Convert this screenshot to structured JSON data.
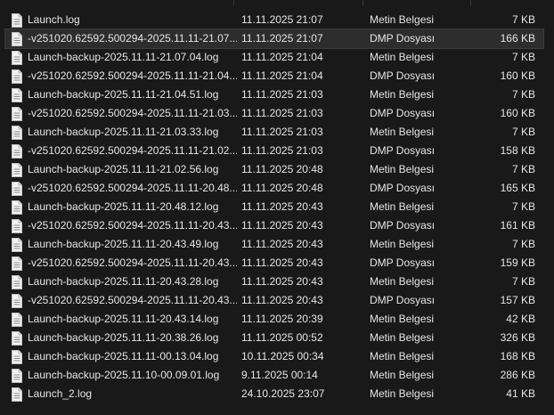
{
  "files": [
    {
      "name": "Launch.log",
      "modified": "11.11.2025 21:07",
      "type": "Metin Belgesi",
      "size": "7 KB"
    },
    {
      "name": "-v251020.62592.500294-2025.11.11-21.07....",
      "modified": "11.11.2025 21:07",
      "type": "DMP Dosyası",
      "size": "166 KB"
    },
    {
      "name": "Launch-backup-2025.11.11-21.07.04.log",
      "modified": "11.11.2025 21:04",
      "type": "Metin Belgesi",
      "size": "7 KB"
    },
    {
      "name": "-v251020.62592.500294-2025.11.11-21.04....",
      "modified": "11.11.2025 21:04",
      "type": "DMP Dosyası",
      "size": "160 KB"
    },
    {
      "name": "Launch-backup-2025.11.11-21.04.51.log",
      "modified": "11.11.2025 21:03",
      "type": "Metin Belgesi",
      "size": "7 KB"
    },
    {
      "name": "-v251020.62592.500294-2025.11.11-21.03....",
      "modified": "11.11.2025 21:03",
      "type": "DMP Dosyası",
      "size": "160 KB"
    },
    {
      "name": "Launch-backup-2025.11.11-21.03.33.log",
      "modified": "11.11.2025 21:03",
      "type": "Metin Belgesi",
      "size": "7 KB"
    },
    {
      "name": "-v251020.62592.500294-2025.11.11-21.02....",
      "modified": "11.11.2025 21:03",
      "type": "DMP Dosyası",
      "size": "158 KB"
    },
    {
      "name": "Launch-backup-2025.11.11-21.02.56.log",
      "modified": "11.11.2025 20:48",
      "type": "Metin Belgesi",
      "size": "7 KB"
    },
    {
      "name": "-v251020.62592.500294-2025.11.11-20.48....",
      "modified": "11.11.2025 20:48",
      "type": "DMP Dosyası",
      "size": "165 KB"
    },
    {
      "name": "Launch-backup-2025.11.11-20.48.12.log",
      "modified": "11.11.2025 20:43",
      "type": "Metin Belgesi",
      "size": "7 KB"
    },
    {
      "name": "-v251020.62592.500294-2025.11.11-20.43....",
      "modified": "11.11.2025 20:43",
      "type": "DMP Dosyası",
      "size": "161 KB"
    },
    {
      "name": "Launch-backup-2025.11.11-20.43.49.log",
      "modified": "11.11.2025 20:43",
      "type": "Metin Belgesi",
      "size": "7 KB"
    },
    {
      "name": "-v251020.62592.500294-2025.11.11-20.43....",
      "modified": "11.11.2025 20:43",
      "type": "DMP Dosyası",
      "size": "159 KB"
    },
    {
      "name": "Launch-backup-2025.11.11-20.43.28.log",
      "modified": "11.11.2025 20:43",
      "type": "Metin Belgesi",
      "size": "7 KB"
    },
    {
      "name": "-v251020.62592.500294-2025.11.11-20.43....",
      "modified": "11.11.2025 20:43",
      "type": "DMP Dosyası",
      "size": "157 KB"
    },
    {
      "name": "Launch-backup-2025.11.11-20.43.14.log",
      "modified": "11.11.2025 20:39",
      "type": "Metin Belgesi",
      "size": "42 KB"
    },
    {
      "name": "Launch-backup-2025.11.11-20.38.26.log",
      "modified": "11.11.2025 00:52",
      "type": "Metin Belgesi",
      "size": "326 KB"
    },
    {
      "name": "Launch-backup-2025.11.11-00.13.04.log",
      "modified": "10.11.2025 00:34",
      "type": "Metin Belgesi",
      "size": "168 KB"
    },
    {
      "name": "Launch-backup-2025.11.10-00.09.01.log",
      "modified": "9.11.2025 00:14",
      "type": "Metin Belgesi",
      "size": "286 KB"
    },
    {
      "name": "Launch_2.log",
      "modified": "24.10.2025 23:07",
      "type": "Metin Belgesi",
      "size": "41 KB"
    }
  ],
  "selected_index": 1,
  "icons": {
    "file": "document-icon"
  },
  "colors": {
    "background": "#191919",
    "text": "#e6e6e6",
    "selection": "#2d2d2d"
  }
}
